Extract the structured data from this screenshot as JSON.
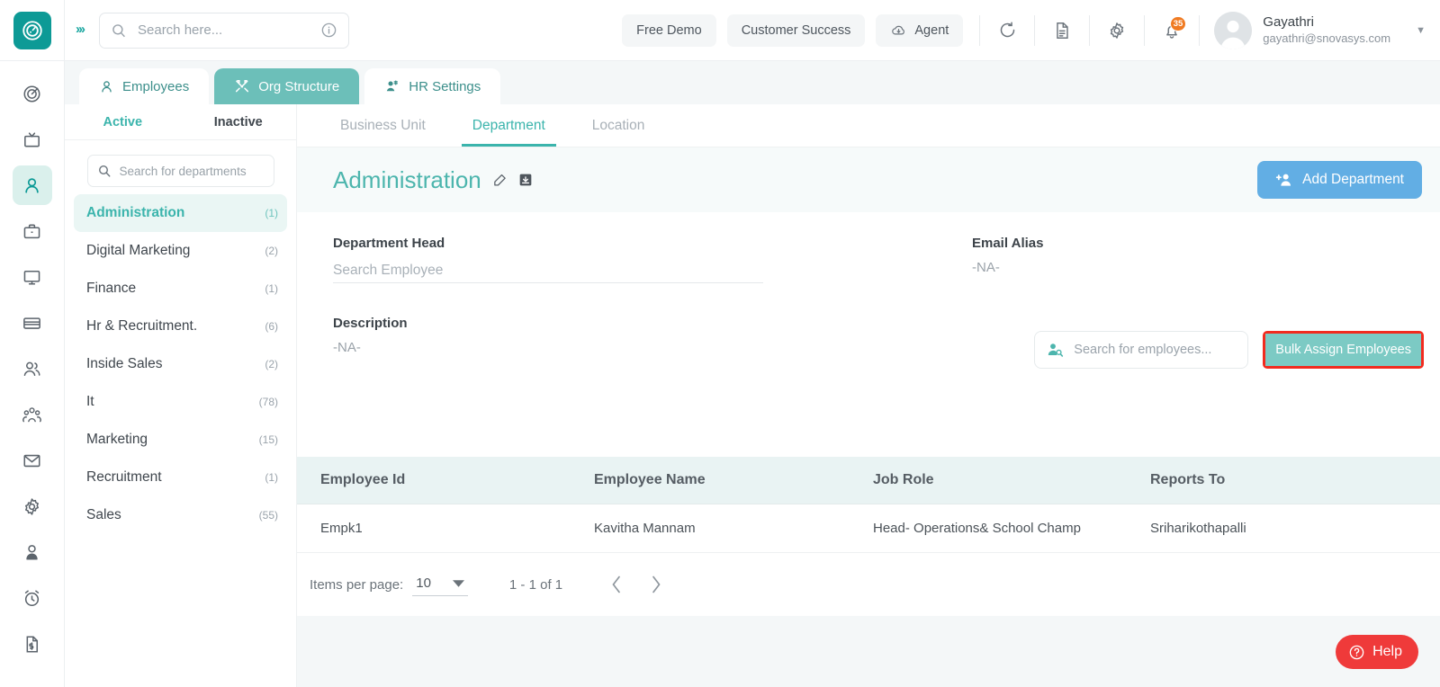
{
  "header": {
    "logo_icon": "clock-logo-icon",
    "expand_icon": "double-chevron-right-icon",
    "search": {
      "value": "",
      "placeholder": "Search here...",
      "icon": "search-icon",
      "info_icon": "info-circle-icon"
    },
    "buttons": [
      {
        "label": "Free Demo",
        "icon": null
      },
      {
        "label": "Customer Success",
        "icon": null
      },
      {
        "label": "Agent",
        "icon": "cloud-download-icon"
      }
    ],
    "icons": [
      {
        "name": "refresh-icon"
      },
      {
        "name": "document-icon"
      },
      {
        "name": "gear-icon"
      },
      {
        "name": "notification-bell-icon",
        "badge": "35"
      }
    ],
    "user": {
      "name": "Gayathri",
      "email": "gayathri@snovasys.com",
      "caret": "▼"
    }
  },
  "rail": {
    "items": [
      {
        "name": "dashboard-target-icon",
        "active": false
      },
      {
        "name": "tv-screen-icon",
        "active": false
      },
      {
        "name": "person-icon",
        "active": true
      },
      {
        "name": "briefcase-icon",
        "active": false
      },
      {
        "name": "monitor-icon",
        "active": false
      },
      {
        "name": "credit-card-icon",
        "active": false
      },
      {
        "name": "two-people-icon",
        "active": false
      },
      {
        "name": "group-people-icon",
        "active": false
      },
      {
        "name": "mail-envelope-icon",
        "active": false
      },
      {
        "name": "settings-gear-icon",
        "active": false
      },
      {
        "name": "user-profile-icon",
        "active": false
      },
      {
        "name": "alarm-clock-icon",
        "active": false
      },
      {
        "name": "invoice-dollar-icon",
        "active": false
      }
    ]
  },
  "module_tabs": [
    {
      "label": "Employees",
      "icon": "person-icon",
      "active": false
    },
    {
      "label": "Org Structure",
      "icon": "tools-icon",
      "active": true
    },
    {
      "label": "HR Settings",
      "icon": "people-settings-icon",
      "active": false
    }
  ],
  "left_panel": {
    "segments": [
      {
        "label": "Active",
        "active": true
      },
      {
        "label": "Inactive",
        "active": false
      }
    ],
    "search": {
      "value": "",
      "placeholder": "Search for departments",
      "icon": "search-icon"
    },
    "departments": [
      {
        "name": "Administration",
        "count": "(1)",
        "active": true
      },
      {
        "name": "Digital Marketing",
        "count": "(2)",
        "active": false
      },
      {
        "name": "Finance",
        "count": "(1)",
        "active": false
      },
      {
        "name": "Hr & Recruitment.",
        "count": "(6)",
        "active": false
      },
      {
        "name": "Inside Sales",
        "count": "(2)",
        "active": false
      },
      {
        "name": "It",
        "count": "(78)",
        "active": false
      },
      {
        "name": "Marketing",
        "count": "(15)",
        "active": false
      },
      {
        "name": "Recruitment",
        "count": "(1)",
        "active": false
      },
      {
        "name": "Sales",
        "count": "(55)",
        "active": false
      }
    ]
  },
  "main": {
    "sub_tabs": [
      {
        "label": "Business Unit",
        "active": false
      },
      {
        "label": "Department",
        "active": true
      },
      {
        "label": "Location",
        "active": false
      }
    ],
    "title": "Administration",
    "title_icons": [
      {
        "name": "edit-pencil-icon"
      },
      {
        "name": "archive-box-icon"
      }
    ],
    "add_button": {
      "label": "Add Department",
      "icon": "add-person-icon",
      "color": "#62aee4"
    },
    "fields": {
      "department_head_label": "Department Head",
      "department_head_placeholder": "Search Employee",
      "department_head_value": "",
      "email_alias_label": "Email Alias",
      "email_alias_value": "-NA-",
      "description_label": "Description",
      "description_value": "-NA-"
    },
    "toolbar": {
      "employee_search": {
        "value": "",
        "placeholder": "Search for employees...",
        "icon": "person-search-icon"
      },
      "bulk_assign_label": "Bulk Assign Employees",
      "bulk_assign_color": "#7ccac4",
      "highlight_color": "#f22b1f"
    },
    "table": {
      "columns": [
        "Employee Id",
        "Employee Name",
        "Job Role",
        "Reports To"
      ],
      "rows": [
        {
          "employee_id": "Empk1",
          "employee_name": "Kavitha Mannam",
          "job_role": "Head- Operations& School Champ",
          "reports_to": "Sriharikothapalli"
        }
      ]
    },
    "paginator": {
      "items_per_page_label": "Items per page:",
      "items_per_page_value": "10",
      "dropdown_icon": "caret-down-icon",
      "range_label": "1 - 1 of 1",
      "prev_icon": "chevron-left-icon",
      "next_icon": "chevron-right-icon"
    }
  },
  "help": {
    "label": "Help",
    "icon": "question-circle-icon",
    "color": "#ef3a3a"
  }
}
